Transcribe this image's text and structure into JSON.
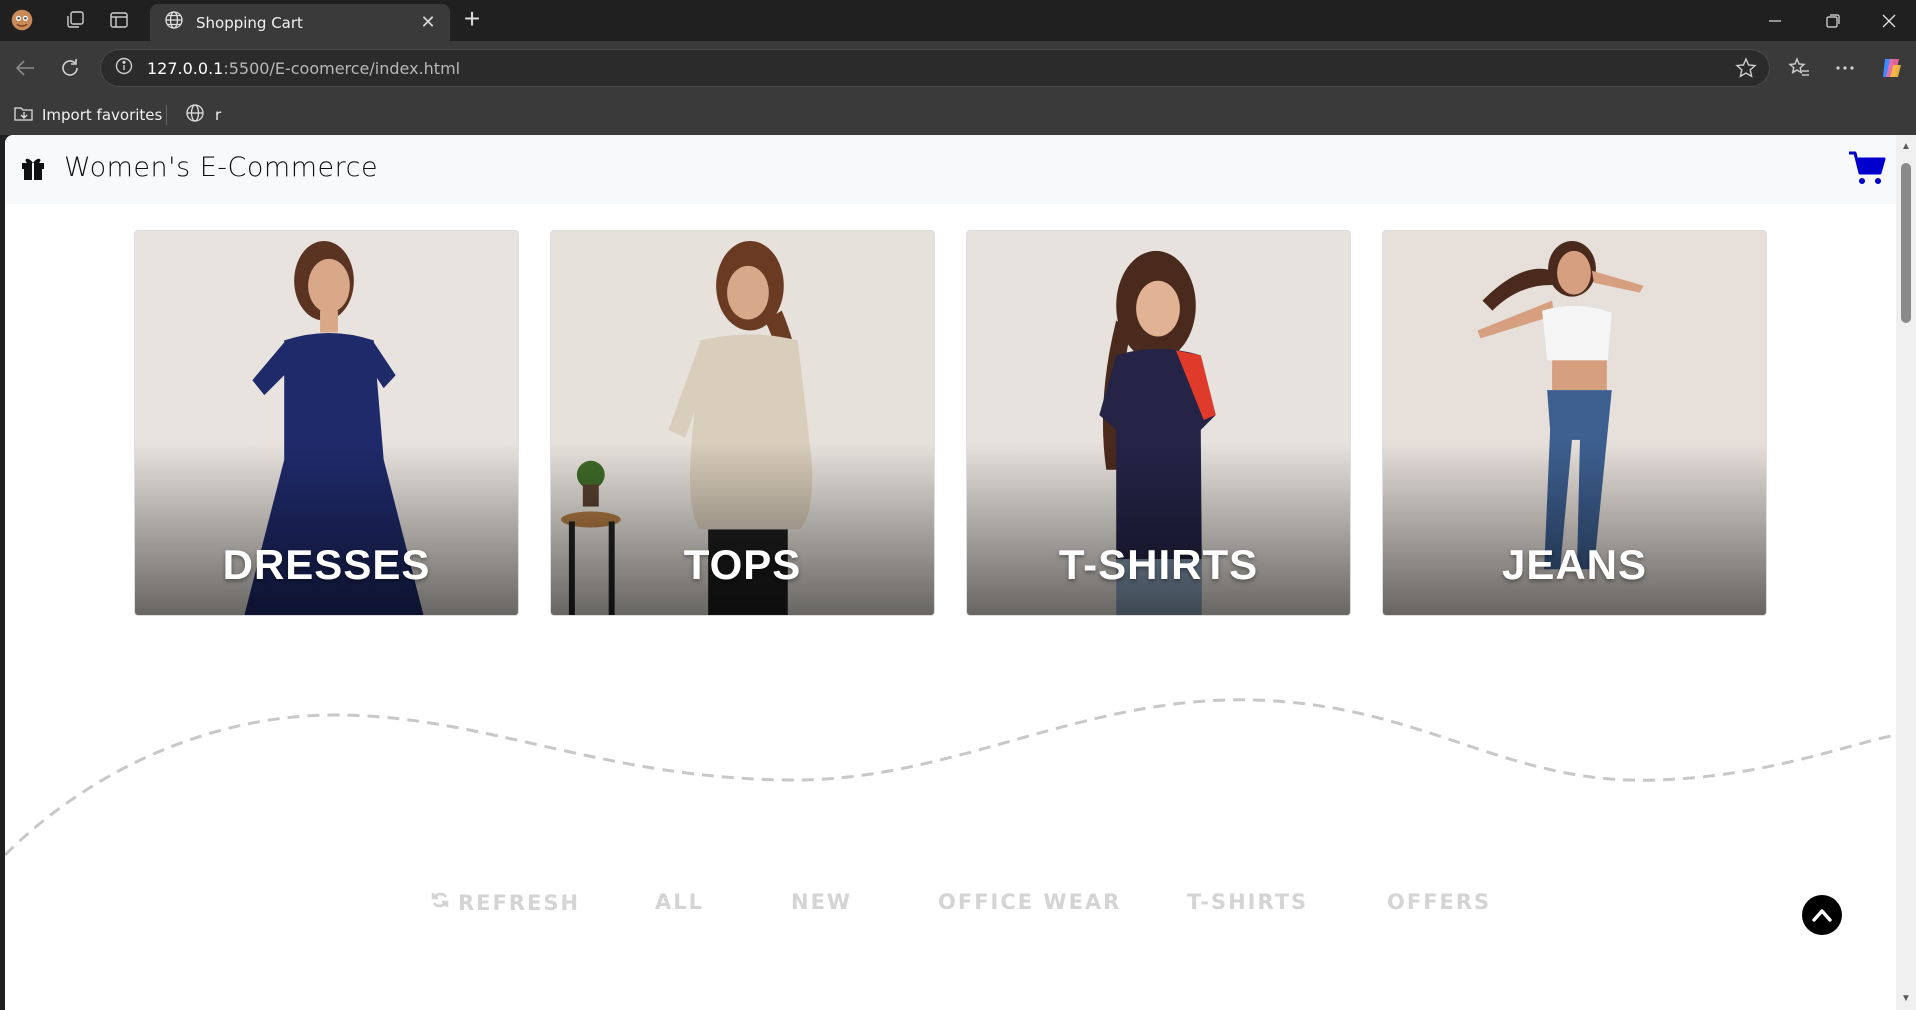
{
  "browser": {
    "tab_title": "Shopping Cart",
    "url_host": "127.0.0.1",
    "url_rest": ":5500/E-coomerce/index.html",
    "bookmarks": [
      "Import favorites",
      "r"
    ]
  },
  "site": {
    "brand": "Women's E-Commerce",
    "accent_color": "#0000cc"
  },
  "categories": [
    {
      "label": "DRESSES",
      "garment_color": "#1f2a6b"
    },
    {
      "label": "TOPS",
      "garment_color": "#d9cdbb"
    },
    {
      "label": "T-SHIRTS",
      "garment_color": "#252447"
    },
    {
      "label": "JEANS",
      "garment_color": "#3d5f8f"
    }
  ],
  "filters": {
    "refresh": "REFRESH",
    "items": [
      "ALL",
      "NEW",
      "OFFICE WEAR",
      "T-SHIRTS",
      "OFFERS"
    ]
  }
}
